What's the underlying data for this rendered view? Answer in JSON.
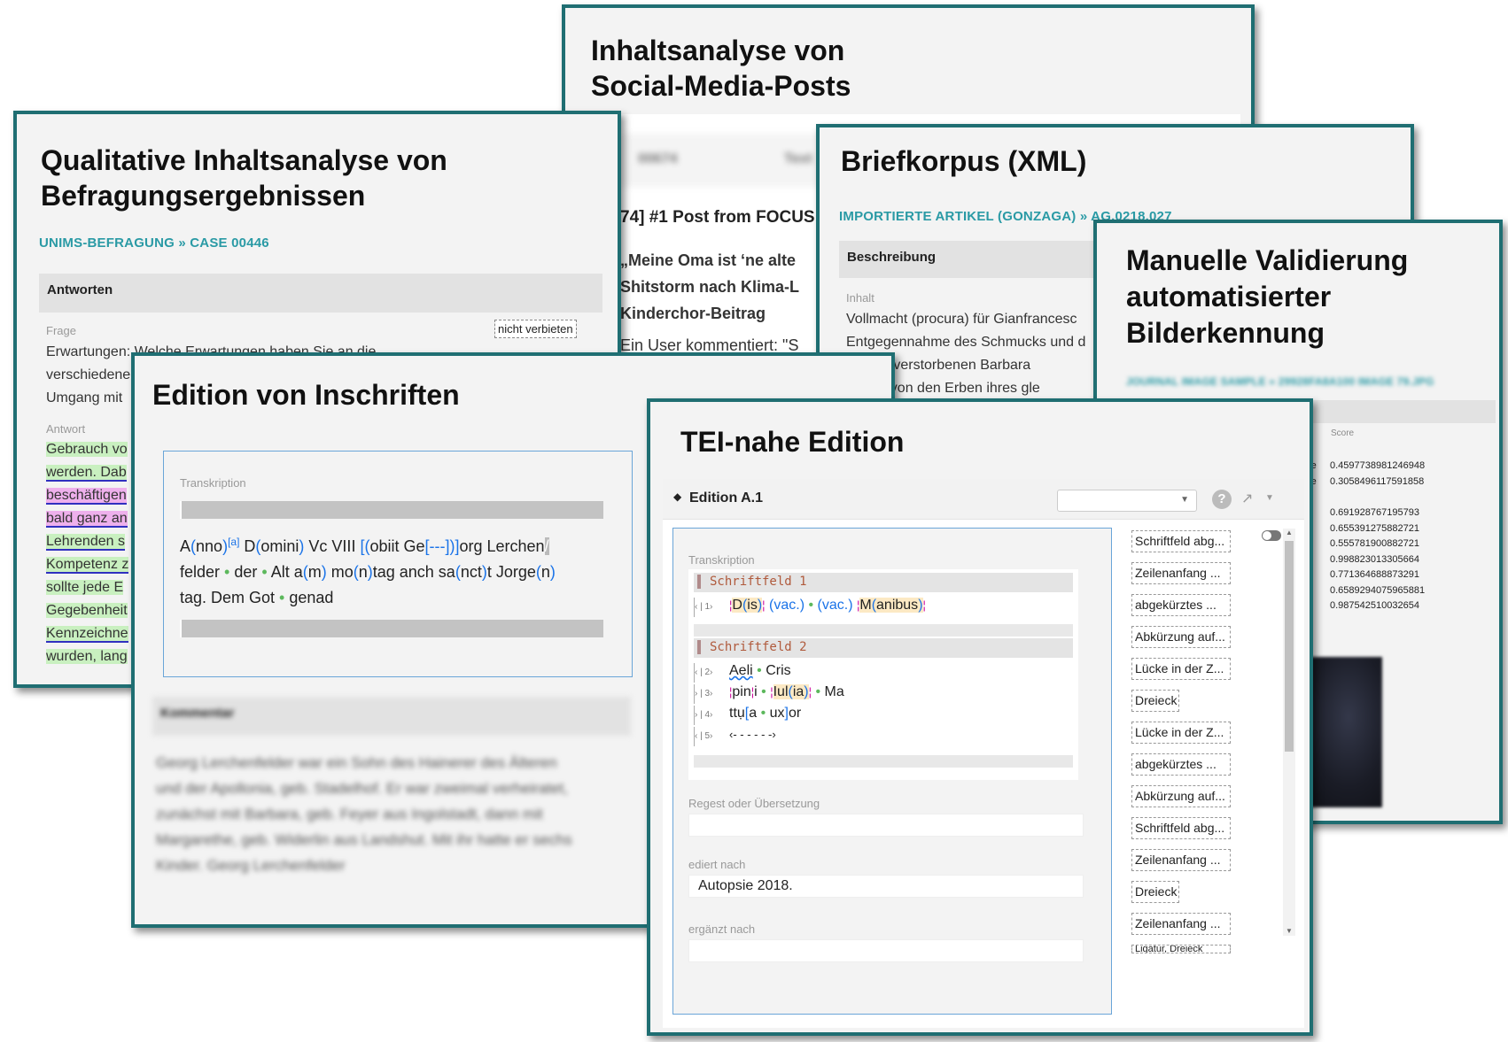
{
  "social": {
    "title_l1": "Inhaltsanalyse von",
    "title_l2": "Social-Media-Posts",
    "bg_id": "00674",
    "bg_word": "Text",
    "post_title": "74] #1 Post from FOCUS",
    "post_l1": "„Meine Oma ist ‘ne alte",
    "post_l2": "Shitstorm nach Klima-L",
    "post_l3": "Kinderchor-Beitrag",
    "post_l4": "Ein User kommentiert: \"S"
  },
  "qual": {
    "title_l1": "Qualitative Inhaltsanalyse von",
    "title_l2": "Befragungsergebnissen",
    "crumb": "UNIMS-BEFRAGUNG » CASE 00446",
    "section": "Antworten",
    "frage_label": "Frage",
    "frage_l1": "Erwartungen: Welche Erwartungen haben Sie an die",
    "frage_l2": "verschiedene",
    "frage_l3": "Umgang mit",
    "badge": "nicht verbieten",
    "antwort_label": "Antwort",
    "answers": [
      "Gebrauch vo",
      "werden. Dab",
      "beschäftigen",
      "bald ganz an",
      "Lehrenden s",
      "Kompetenz z",
      "sollte jede E",
      "Gegebenheit",
      "Kennzeichne",
      "wurden, lang"
    ]
  },
  "brief": {
    "title": "Briefkorpus (XML)",
    "crumb": "IMPORTIERTE ARTIKEL (GONZAGA) » AG.0218.027",
    "section": "Beschreibung",
    "inhalt_label": "Inhalt",
    "l1": "Vollmacht (procura) für Gianfrancesc",
    "l2": "Entgegennahme des Schmucks und d",
    "l3": "gift der verstorbenen Barbara",
    "l4": "mberg von den Erben ihres gle"
  },
  "manual": {
    "title_l1": "Manuelle Validierung",
    "title_l2": "automatisierter",
    "title_l3": "Bilderkennung",
    "blur_crumb": "JOURNAL IMAGE SAMPLE » 29928FA8A100 IMAGE 79.JPG",
    "score_label": "Score",
    "rows": [
      {
        "prefix": "able",
        "v": "0.4597738981246948"
      },
      {
        "prefix": "able",
        "v": "0.3058496117591858"
      },
      {
        "prefix": "",
        "v": "0.691928767195793"
      },
      {
        "prefix": "",
        "v": "0.655391275882721"
      },
      {
        "prefix": "n",
        "v": "0.555781900882721"
      },
      {
        "prefix": "",
        "v": "0.998823013305664"
      },
      {
        "prefix": "",
        "v": "0.771364688873291"
      },
      {
        "prefix": "",
        "v": "0.6589294075965881"
      },
      {
        "prefix": "",
        "v": "0.987542510032654"
      }
    ]
  },
  "inschrift": {
    "title": "Edition von Inschriften",
    "transkr_label": "Transkription",
    "note_sup": "[a]",
    "kommentar_label": "Kommentar",
    "blur_text": "Georg Lerchenfelder war ein Sohn des Hainerer des Älteren und der Apollonia, geb. Stadelhof. Er war zweimal verheiratet, zunächst mit Barbara, geb. Feyer aus Ingolstadt, dann mit Margarethe, geb. Widerlin aus Landshut. Mit ihr hatte er sechs Kinder. Georg Lerchenfelder"
  },
  "tei": {
    "title": "TEI-nahe Edition",
    "edition": "Edition A.1",
    "help": "?",
    "transkr_label": "Transkription",
    "sf1": "Schriftfeld 1",
    "sf2": "Schriftfeld 2",
    "ln1": "1",
    "ln2": "2",
    "ln3": "3",
    "ln4": "4",
    "ln5": "5",
    "regest_label": "Regest oder Übersetzung",
    "ediert_label": "ediert nach",
    "ediert_value": "Autopsie 2018.",
    "ergaenzt_label": "ergänzt nach",
    "tags": [
      "Schriftfeld abg...",
      "Zeilenanfang ...",
      "abgekürztes ...",
      "Abkürzung auf...",
      "Lücke in der Z...",
      "Dreieck",
      "Lücke in der Z...",
      "abgekürztes ...",
      "Abkürzung auf...",
      "Schriftfeld abg...",
      "Zeilenanfang ...",
      "Dreieck",
      "Zeilenanfang ...",
      "Ligatur, Dreieck"
    ]
  },
  "colors": {
    "border": "#1f6e72",
    "accent": "#2a9aa5",
    "green_hl": "#c9f0c0",
    "pink_hl": "#eeb0ec",
    "blue_text": "#1a73e8"
  }
}
